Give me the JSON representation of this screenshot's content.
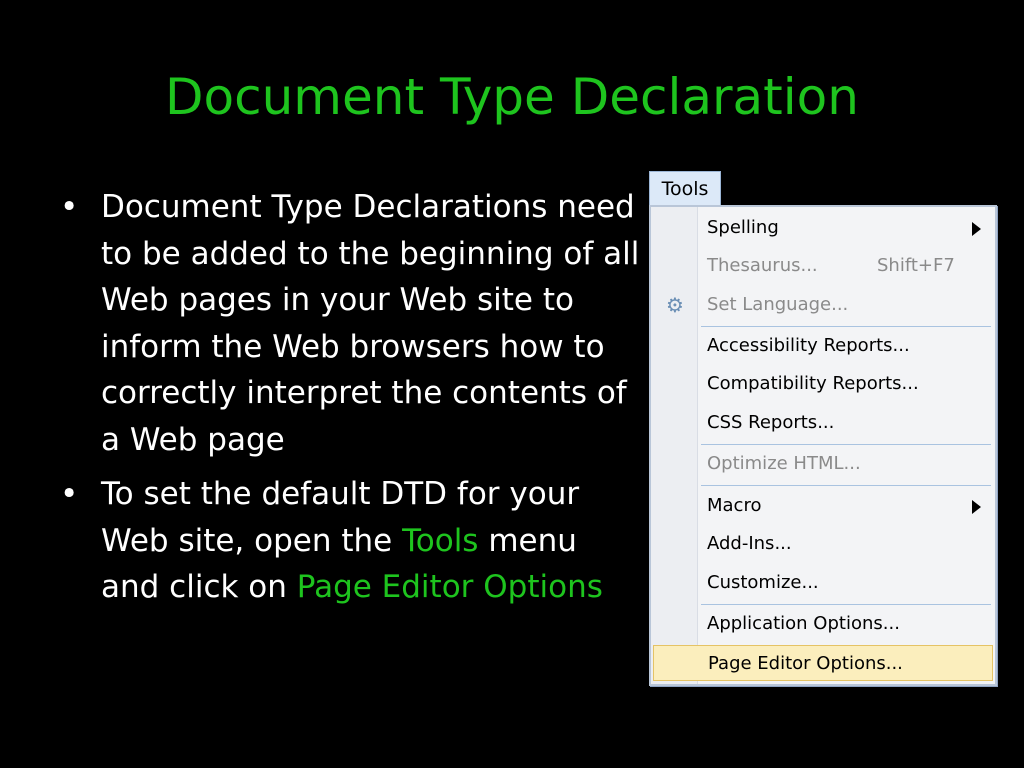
{
  "slide": {
    "title": "Document Type Declaration",
    "bullets": [
      {
        "text": "Document Type Declarations need to be added to the beginning of all Web pages in your Web site to inform the Web browsers how to correctly interpret the contents of a Web page"
      },
      {
        "pre": "To set the default DTD for your Web site, open the ",
        "hl1": "Tools",
        "mid": " menu and click on ",
        "hl2": "Page Editor Options"
      }
    ]
  },
  "menu": {
    "title": "Tools",
    "items": [
      {
        "label": "Spelling",
        "submenu": true
      },
      {
        "label": "Thesaurus...",
        "shortcut": "Shift+F7",
        "disabled": true
      },
      {
        "label": "Set Language...",
        "disabled": true,
        "icon": "language-gear-icon"
      },
      {
        "label": "Accessibility Reports..."
      },
      {
        "label": "Compatibility Reports..."
      },
      {
        "label": "CSS Reports..."
      },
      {
        "label": "Optimize HTML...",
        "disabled": true
      },
      {
        "label": "Macro",
        "submenu": true
      },
      {
        "label": "Add-Ins..."
      },
      {
        "label": "Customize..."
      },
      {
        "label": "Application Options..."
      },
      {
        "label": "Page Editor Options...",
        "highlighted": true
      }
    ]
  },
  "colors": {
    "title": "#1ec41e",
    "highlight_text": "#1ec41e",
    "background": "#000000",
    "menu_highlight": "#fbeebd"
  }
}
